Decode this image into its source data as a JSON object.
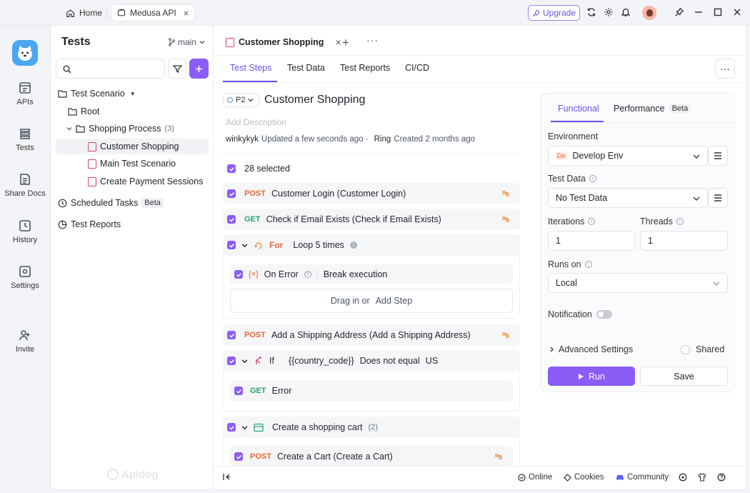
{
  "titlebar": {
    "home_tab": "Home",
    "project_tab": "Medusa API",
    "upgrade": "Upgrade",
    "icons": [
      "refresh-icon",
      "gear-icon",
      "bell-icon",
      "avatar",
      "pin-icon",
      "minimize-icon",
      "maximize-icon",
      "close-icon"
    ]
  },
  "rail": {
    "items": [
      {
        "label": "APIs",
        "icon": "api-icon"
      },
      {
        "label": "Tests",
        "icon": "tests-icon"
      },
      {
        "label": "Share Docs",
        "icon": "docs-icon"
      },
      {
        "label": "History",
        "icon": "history-icon"
      },
      {
        "label": "Settings",
        "icon": "settings-icon"
      },
      {
        "label": "Invite",
        "icon": "invite-icon"
      }
    ]
  },
  "sidebar": {
    "title": "Tests",
    "branch": "main",
    "tree": {
      "test_scenario": "Test Scenario",
      "root": "Root",
      "shopping_process": "Shopping Process",
      "shopping_process_count": "(3)",
      "items": [
        "Customer Shopping",
        "Main Test Scenario",
        "Create Payment Sessions"
      ],
      "scheduled_tasks": "Scheduled Tasks",
      "scheduled_badge": "Beta",
      "test_reports": "Test Reports"
    },
    "watermark": "Apidog"
  },
  "main": {
    "doc_tab": "Customer Shopping",
    "subtabs": [
      "Test Steps",
      "Test Data",
      "Test Reports",
      "CI/CD"
    ],
    "priority": "P2",
    "title": "Customer Shopping",
    "description_placeholder": "Add Description",
    "meta": {
      "updater": "winkykyk",
      "updated": "Updated a few seconds ago ·",
      "creator": "Ring",
      "created": "Created 2 months ago"
    },
    "selected": "28 selected",
    "steps": {
      "s1_method": "POST",
      "s1_name": "Customer Login (Customer Login)",
      "s2_method": "GET",
      "s2_name": "Check if Email Exists (Check if Email Exists)",
      "loop_kw": "For",
      "loop_text": "Loop 5 times",
      "on_error": "On Error",
      "on_error_action": "Break execution",
      "drag_text": "Drag in or",
      "add_step": "Add Step",
      "s3_method": "POST",
      "s3_name": "Add a Shipping Address (Add a Shipping Address)",
      "if_kw": "If",
      "if_var": "{{country_code}}",
      "if_op": "Does not equal",
      "if_val": "US",
      "s4_method": "GET",
      "s4_name": "Error",
      "group_name": "Create a shopping cart",
      "group_count": "(2)",
      "s5_method": "POST",
      "s5_name": "Create a Cart (Create a Cart)"
    }
  },
  "panel": {
    "tabs": [
      "Functional",
      "Performance"
    ],
    "perf_badge": "Beta",
    "environment_label": "Environment",
    "environment_prefix": "De",
    "environment_value": "Develop Env",
    "test_data_label": "Test Data",
    "test_data_value": "No Test Data",
    "iterations_label": "Iterations",
    "iterations_value": "1",
    "threads_label": "Threads",
    "threads_value": "1",
    "runs_on_label": "Runs on",
    "runs_on_value": "Local",
    "notification_label": "Notification",
    "notification_on": false,
    "advanced_label": "Advanced Settings",
    "shared_label": "Shared",
    "run": "Run",
    "save": "Save"
  },
  "footer": {
    "online": "Online",
    "cookies": "Cookies",
    "community": "Community"
  },
  "colors": {
    "accent": "#8b5cf6",
    "post": "#e36b3a",
    "get": "#27a86d"
  }
}
